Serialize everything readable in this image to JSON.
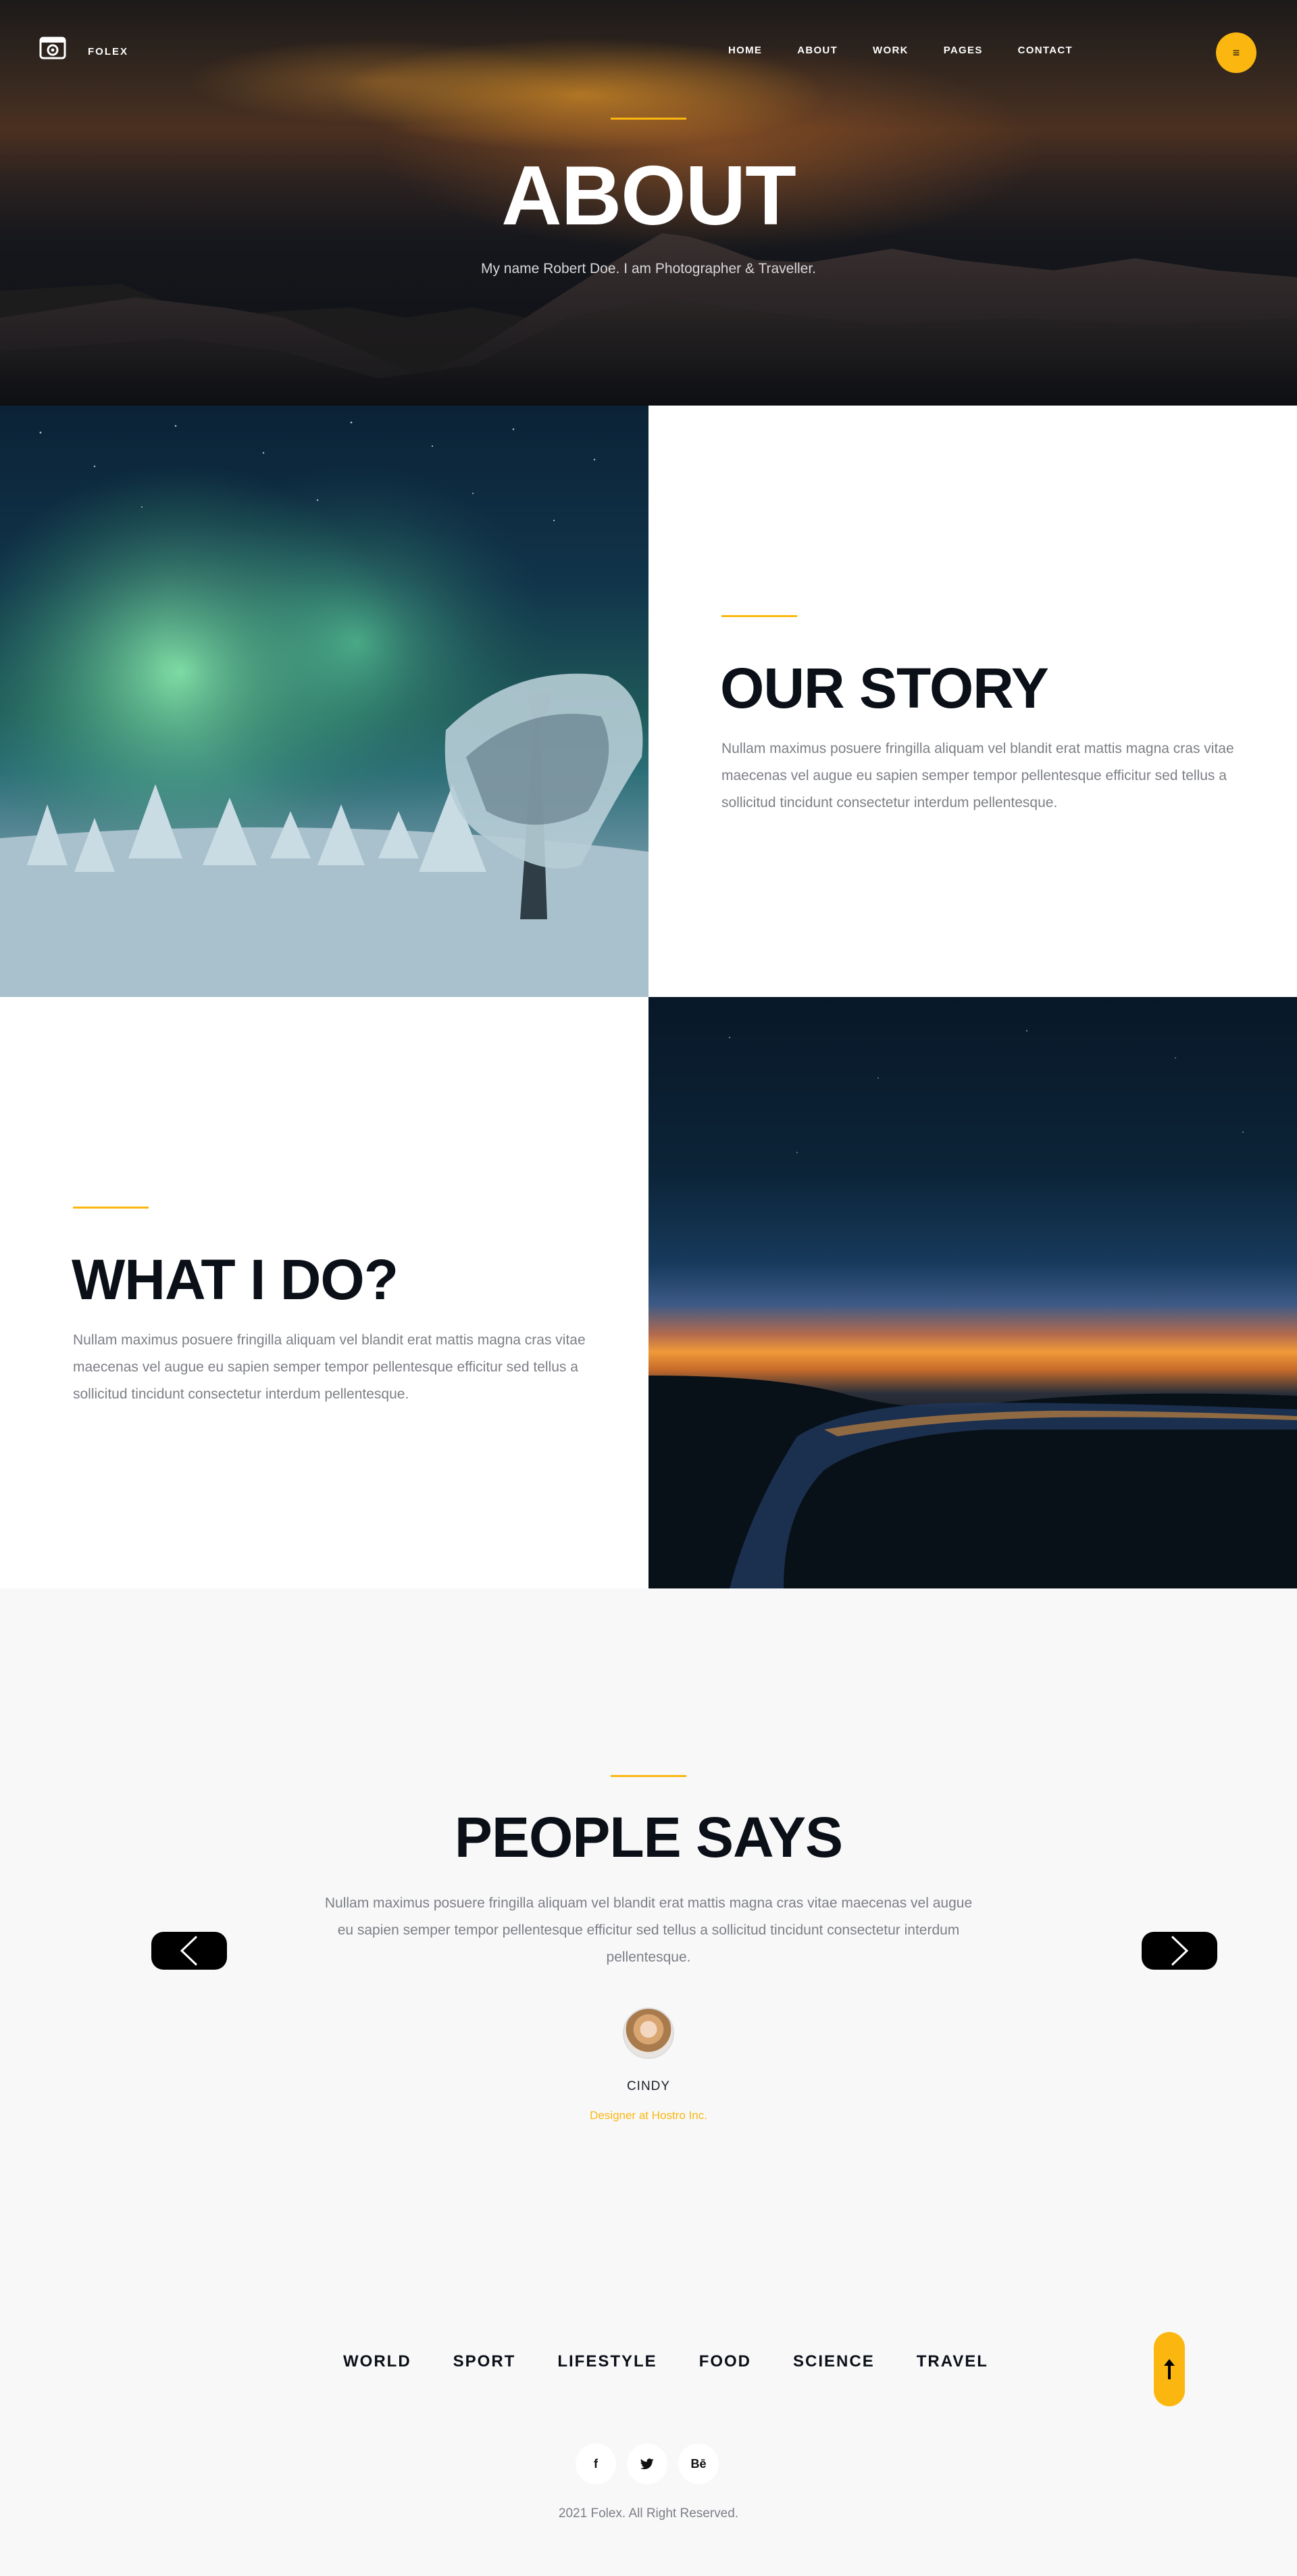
{
  "brand": {
    "name": "FOLEX",
    "accent": "#fbb710"
  },
  "nav": {
    "items": [
      {
        "label": "HOME"
      },
      {
        "label": "ABOUT"
      },
      {
        "label": "WORK"
      },
      {
        "label": "PAGES"
      },
      {
        "label": "CONTACT"
      }
    ],
    "menu_icon": "hamburger-icon"
  },
  "hero": {
    "title": "ABOUT",
    "subtitle": "My name Robert Doe. I am Photographer & Traveller."
  },
  "story": {
    "title": "OUR STORY",
    "text": "Nullam maximus posuere fringilla aliquam vel blandit erat mattis magna cras vitae maecenas vel augue eu sapien semper tempor pellentesque efficitur sed tellus a sollicitud tincidunt consectetur interdum pellentesque."
  },
  "whatido": {
    "title": "WHAT I DO?",
    "text": "Nullam maximus posuere fringilla aliquam vel blandit erat mattis magna cras vitae maecenas vel augue eu sapien semper tempor pellentesque efficitur sed tellus a sollicitud tincidunt consectetur interdum pellentesque."
  },
  "testimonials": {
    "title": "PEOPLE SAYS",
    "text": "Nullam maximus posuere fringilla aliquam vel blandit erat mattis magna cras vitae maecenas vel augue eu sapien semper tempor pellentesque efficitur sed tellus a sollicitud tincidunt consectetur interdum pellentesque.",
    "name": "CINDY",
    "role": "Designer at Hostro Inc.",
    "prev_icon": "chevron-left-icon",
    "next_icon": "chevron-right-icon"
  },
  "footer": {
    "categories": [
      {
        "label": "WORLD"
      },
      {
        "label": "SPORT"
      },
      {
        "label": "LIFESTYLE"
      },
      {
        "label": "FOOD"
      },
      {
        "label": "SCIENCE"
      },
      {
        "label": "TRAVEL"
      }
    ],
    "socials": [
      {
        "label": "f",
        "icon": "facebook-icon"
      },
      {
        "label": "",
        "icon": "twitter-icon"
      },
      {
        "label": "Bē",
        "icon": "behance-icon"
      }
    ],
    "copyright": "2021 Folex. All Right Reserved.",
    "back_to_top_icon": "arrow-up-icon"
  }
}
